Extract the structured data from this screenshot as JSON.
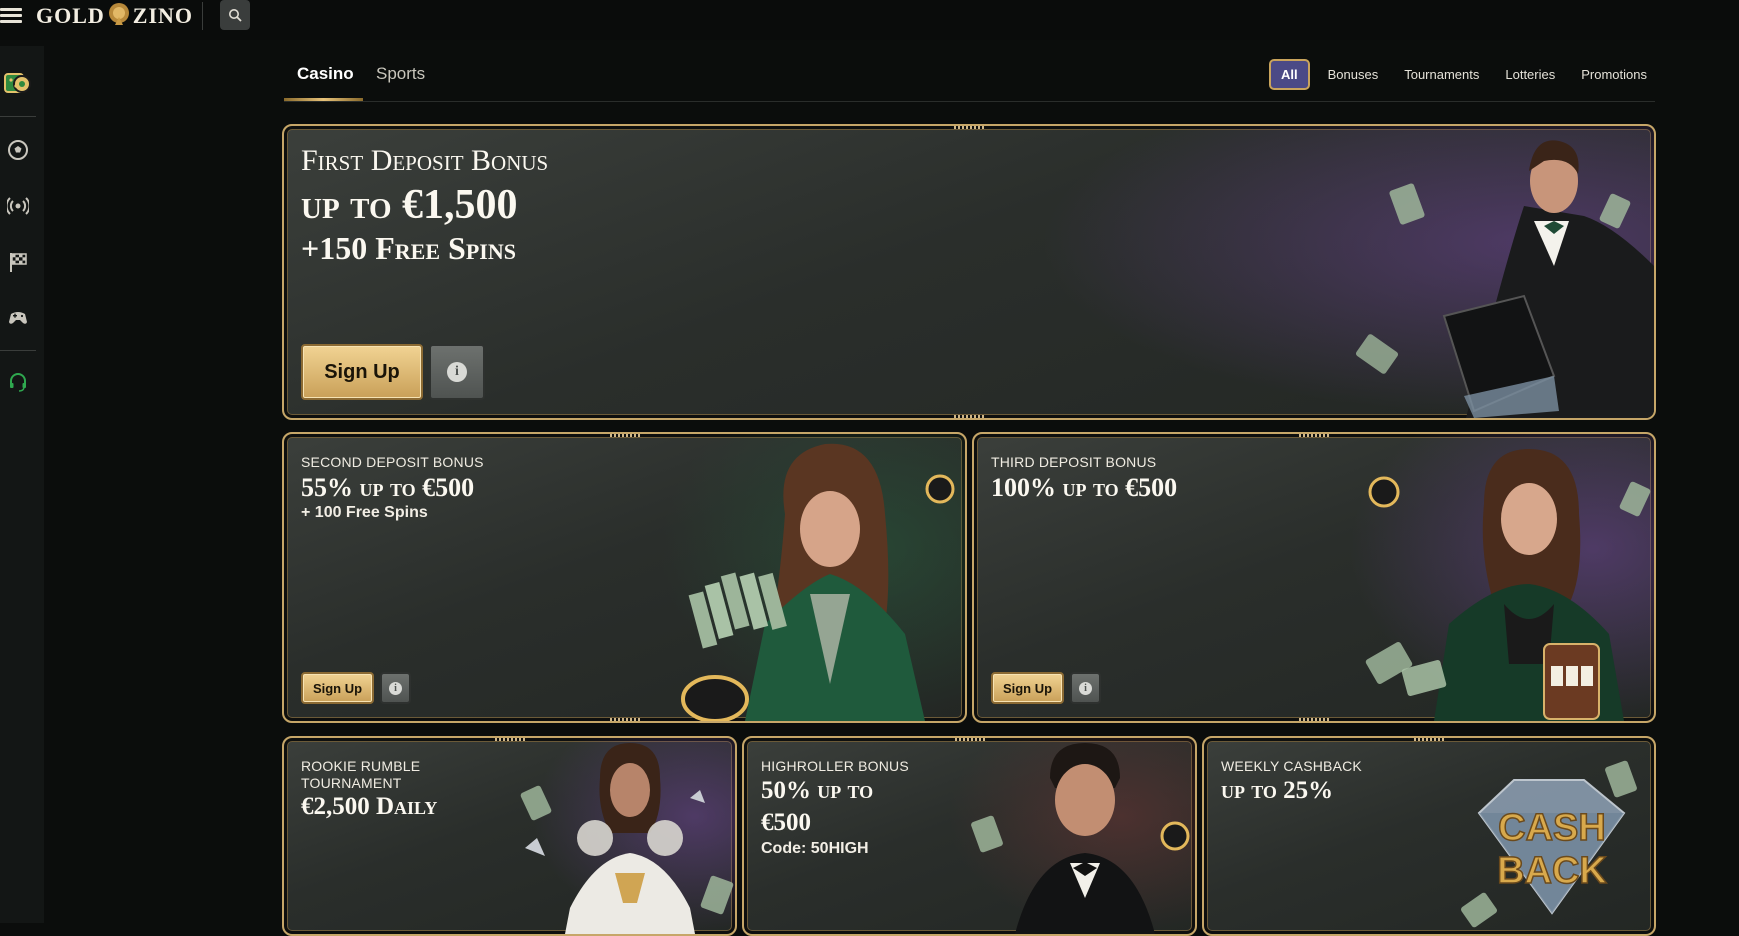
{
  "brand": {
    "logo_left": "GOLD",
    "logo_right": "ZINO"
  },
  "header": {
    "menu_icon": "hamburger-icon",
    "search_icon": "search-icon"
  },
  "sidebar": {
    "items": [
      {
        "name": "casino-icon"
      },
      {
        "name": "soccer-ball-icon"
      },
      {
        "name": "live-icon"
      },
      {
        "name": "racing-flag-icon"
      },
      {
        "name": "esports-gamepad-icon"
      },
      {
        "name": "support-headset-icon"
      }
    ],
    "support_color": "#2fa84f"
  },
  "tabs": [
    {
      "label": "Casino",
      "active": true
    },
    {
      "label": "Sports",
      "active": false
    }
  ],
  "filters": [
    {
      "label": "All",
      "active": true
    },
    {
      "label": "Bonuses",
      "active": false
    },
    {
      "label": "Tournaments",
      "active": false
    },
    {
      "label": "Lotteries",
      "active": false
    },
    {
      "label": "Promotions",
      "active": false
    }
  ],
  "cards": {
    "first": {
      "kicker": "First Deposit Bonus",
      "headline": "up to €1,500",
      "sub": "+150 Free Spins",
      "signup": "Sign Up",
      "info_icon": "info-icon"
    },
    "second": {
      "kicker": "Second Deposit Bonus",
      "headline": "55% up to €500",
      "sub": "+ 100 Free Spins",
      "signup": "Sign Up"
    },
    "third": {
      "kicker": "Third Deposit Bonus",
      "headline": "100% up to €500",
      "signup": "Sign Up"
    },
    "rookie": {
      "kicker_line1": "Rookie Rumble",
      "kicker_line2": "Tournament",
      "headline": "€2,500 Daily"
    },
    "highroller": {
      "kicker": "Highroller Bonus",
      "headline_line1": "50% up to",
      "headline_line2": "€500",
      "code": "Code: 50HIGH"
    },
    "weekly": {
      "kicker": "Weekly Cashback",
      "headline": "up to 25%",
      "badge_line1": "CASH",
      "badge_line2": "BACK"
    }
  },
  "colors": {
    "gold": "#c6a668",
    "filter_active": "#4b4a86",
    "background": "#0b0d0c"
  }
}
